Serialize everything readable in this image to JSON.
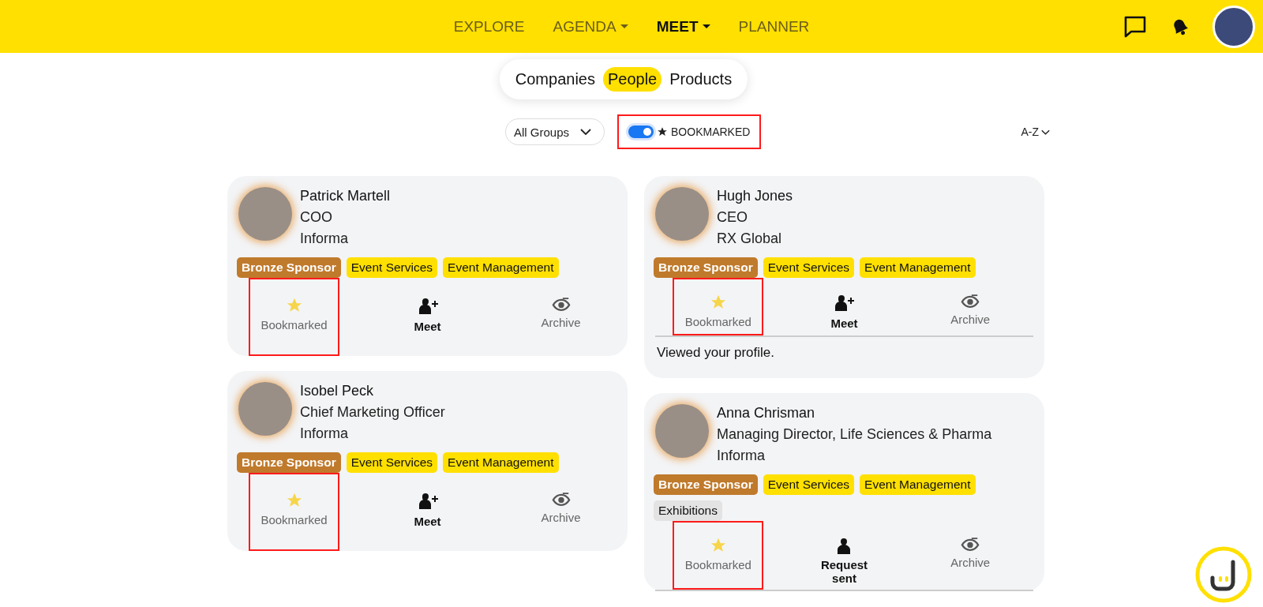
{
  "nav": {
    "items": [
      {
        "label": "EXPLORE",
        "selected": false,
        "has_menu": false
      },
      {
        "label": "AGENDA",
        "selected": false,
        "has_menu": true
      },
      {
        "label": "MEET",
        "selected": true,
        "has_menu": true
      },
      {
        "label": "PLANNER",
        "selected": false,
        "has_menu": false
      }
    ]
  },
  "segments": [
    {
      "label": "Companies",
      "selected": false
    },
    {
      "label": "People",
      "selected": true
    },
    {
      "label": "Products",
      "selected": false
    }
  ],
  "filters": {
    "group_dropdown": "All Groups",
    "bookmarked_toggle": {
      "on": true,
      "label": "BOOKMARKED",
      "highlighted": true
    },
    "sort": "A-Z"
  },
  "columns": [
    {
      "cards": [
        {
          "name": "Patrick Martell",
          "title": "COO",
          "company": "Informa",
          "tags": [
            {
              "label": "Bronze Sponsor",
              "kind": "sponsor"
            },
            {
              "label": "Event Services",
              "kind": "category"
            },
            {
              "label": "Event Management",
              "kind": "category"
            }
          ],
          "actions": [
            {
              "kind": "bookmark",
              "label": "Bookmarked",
              "highlighted": true
            },
            {
              "kind": "meet",
              "label": "Meet",
              "highlighted": false
            },
            {
              "kind": "archive",
              "label": "Archive",
              "highlighted": false
            }
          ],
          "divider": false
        },
        {
          "name": "Isobel Peck",
          "title": "Chief Marketing Officer",
          "company": "Informa",
          "tags": [
            {
              "label": "Bronze Sponsor",
              "kind": "sponsor"
            },
            {
              "label": "Event Services",
              "kind": "category"
            },
            {
              "label": "Event Management",
              "kind": "category"
            }
          ],
          "actions": [
            {
              "kind": "bookmark",
              "label": "Bookmarked",
              "highlighted": true
            },
            {
              "kind": "meet",
              "label": "Meet",
              "highlighted": false
            },
            {
              "kind": "archive",
              "label": "Archive",
              "highlighted": false
            }
          ],
          "divider": false
        }
      ]
    },
    {
      "cards": [
        {
          "name": "Hugh Jones",
          "title": "CEO",
          "company": "RX Global",
          "tags": [
            {
              "label": "Bronze Sponsor",
              "kind": "sponsor"
            },
            {
              "label": "Event Services",
              "kind": "category"
            },
            {
              "label": "Event Management",
              "kind": "category"
            }
          ],
          "actions": [
            {
              "kind": "bookmark",
              "label": "Bookmarked",
              "highlighted": true
            },
            {
              "kind": "meet",
              "label": "Meet",
              "highlighted": false
            },
            {
              "kind": "archive",
              "label": "Archive",
              "highlighted": false
            }
          ],
          "divider": true,
          "note": "Viewed your profile."
        },
        {
          "name": "Anna Chrisman",
          "title": "Managing Director, Life Sciences & Pharma",
          "company": "Informa",
          "tags": [
            {
              "label": "Bronze Sponsor",
              "kind": "sponsor"
            },
            {
              "label": "Event Services",
              "kind": "category"
            },
            {
              "label": "Event Management",
              "kind": "category"
            },
            {
              "label": "Exhibitions",
              "kind": "other"
            }
          ],
          "actions": [
            {
              "kind": "bookmark",
              "label": "Bookmarked",
              "highlighted": true
            },
            {
              "kind": "request",
              "label": "Request sent",
              "highlighted": false
            },
            {
              "kind": "archive",
              "label": "Archive",
              "highlighted": false
            }
          ],
          "divider": true
        }
      ]
    }
  ]
}
